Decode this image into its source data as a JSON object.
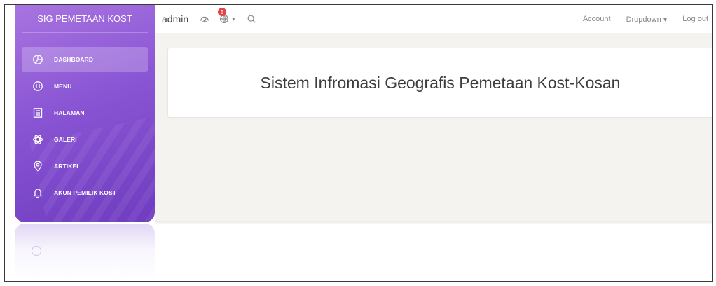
{
  "sidebar": {
    "title": "SIG PEMETAAN KOST",
    "items": [
      {
        "label": "DASHBOARD",
        "icon": "pie-chart-icon",
        "active": true
      },
      {
        "label": "MENU",
        "icon": "menu-circle-icon",
        "active": false
      },
      {
        "label": "HALAMAN",
        "icon": "document-icon",
        "active": false
      },
      {
        "label": "GALERI",
        "icon": "atom-icon",
        "active": false
      },
      {
        "label": "ARTIKEL",
        "icon": "map-pin-icon",
        "active": false
      },
      {
        "label": "AKUN PEMILIK KOST",
        "icon": "bell-icon",
        "active": false
      }
    ]
  },
  "topbar": {
    "brand": "admin",
    "notification_count": "5",
    "caret": "▾",
    "right_links": [
      "Account",
      "Dropdown ▾",
      "Log out"
    ]
  },
  "main": {
    "heading": "Sistem Infromasi Geografis Pemetaan Kost-Kosan"
  },
  "colors": {
    "sidebar_top": "#a874e0",
    "sidebar_bottom": "#6f3cc0",
    "badge": "#e04646",
    "content_bg": "#f4f3ef"
  }
}
